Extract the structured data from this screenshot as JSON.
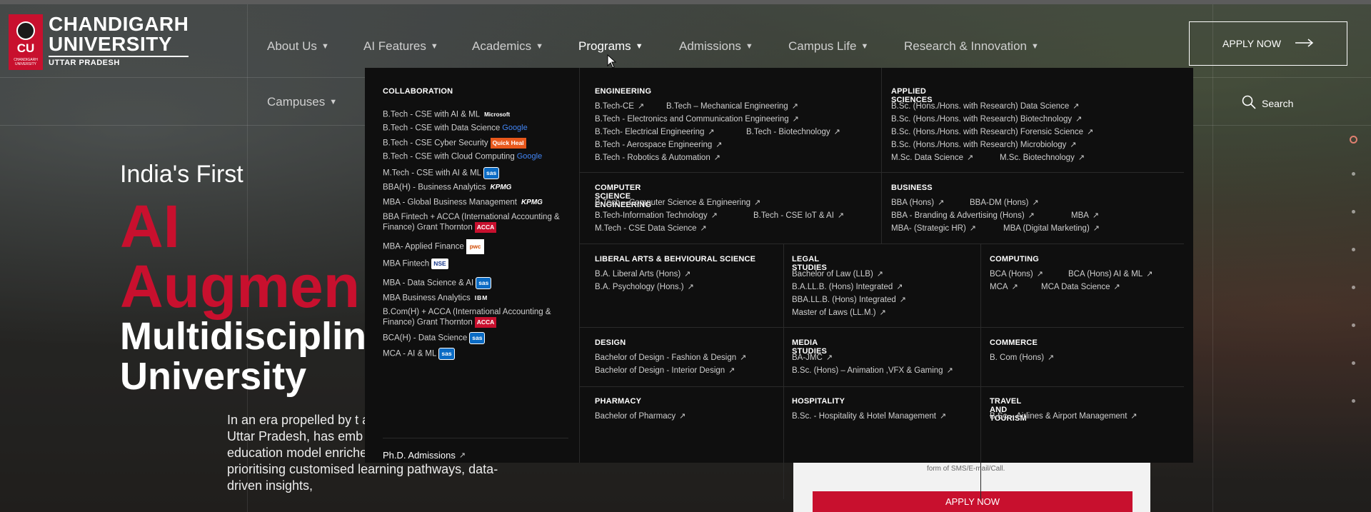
{
  "logo": {
    "line1": "CHANDIGARH",
    "line2": "UNIVERSITY",
    "line3": "UTTAR PRADESH",
    "badge": "CU",
    "badge_sub": "CHANDIGARH UNIVERSITY"
  },
  "nav": {
    "items": [
      {
        "label": "About Us"
      },
      {
        "label": "AI Features"
      },
      {
        "label": "Academics"
      },
      {
        "label": "Programs"
      },
      {
        "label": "Admissions"
      },
      {
        "label": "Campus Life"
      },
      {
        "label": "Research & Innovation"
      },
      {
        "label": "Campuses"
      }
    ],
    "apply_label": "APPLY NOW",
    "search_label": "Search"
  },
  "hero": {
    "line1": "India's First",
    "line2": "AI Augmen",
    "line3": "Multidisciplin University",
    "paragraph": "In an era propelled by t artificial intelligence, Cl Uttar Pradesh, has emb multidisciplinary education model enriched by AI integration, prioritising customised learning pathways, data-driven insights,"
  },
  "form": {
    "note": "form of SMS/E-mail/Call.",
    "apply_label": "APPLY NOW"
  },
  "menu": {
    "collaboration": {
      "heading": "COLLABORATION",
      "items": [
        {
          "label": "B.Tech - CSE with AI & ML",
          "partner": "Microsoft"
        },
        {
          "label": "B.Tech - CSE with Data Science",
          "partner": "Google"
        },
        {
          "label": "B.Tech - CSE Cyber Security",
          "partner": "Quick Heal"
        },
        {
          "label": "B.Tech - CSE with Cloud Computing",
          "partner": "Google"
        },
        {
          "label": "M.Tech - CSE with AI & ML",
          "partner": "sas"
        },
        {
          "label": "BBA(H) - Business Analytics",
          "partner": "KPMG"
        },
        {
          "label": "MBA - Global Business Management",
          "partner": "KPMG"
        },
        {
          "label": "BBA Fintech + ACCA (International Accounting & Finance) Grant Thornton",
          "partner": "ACCA"
        },
        {
          "label": "MBA- Applied Finance",
          "partner": "pwc"
        },
        {
          "label": "MBA Fintech",
          "partner": "NSE"
        },
        {
          "label": "MBA - Data Science & AI",
          "partner": "sas"
        },
        {
          "label": "MBA Business Analytics",
          "partner": "IBM"
        },
        {
          "label": "B.Com(H) + ACCA (International Accounting & Finance) Grant Thornton",
          "partner": "ACCA"
        },
        {
          "label": "BCA(H) - Data Science",
          "partner": "sas"
        },
        {
          "label": "MCA - AI & ML",
          "partner": "sas"
        }
      ],
      "phd": "Ph.D. Admissions"
    },
    "engineering": {
      "heading": "ENGINEERING",
      "items": [
        "B.Tech-CE",
        "B.Tech – Mechanical Engineering",
        "B.Tech - Electronics and Communication Engineering",
        "B.Tech- Electrical Engineering",
        "B.Tech - Biotechnology",
        "B.Tech - Aerospace Engineering",
        "B.Tech - Robotics & Automation"
      ]
    },
    "applied": {
      "heading": "APPLIED SCIENCES",
      "items": [
        "B.Sc. (Hons./Hons. with Research) Data Science",
        "B.Sc. (Hons./Hons. with Research) Biotechnology",
        "B.Sc. (Hons./Hons. with Research) Forensic Science",
        "B.Sc. (Hons./Hons. with Research) Microbiology",
        "M.Sc. Data Science",
        "M.Sc. Biotechnology"
      ]
    },
    "cse": {
      "heading": "COMPUTER SCIENCE ENGINEERING",
      "items": [
        "B.Tech – Computer Science & Engineering",
        "B.Tech-Information Technology",
        "B.Tech - CSE IoT & AI",
        "M.Tech - CSE Data Science"
      ]
    },
    "business": {
      "heading": "BUSINESS",
      "items": [
        "BBA (Hons)",
        "BBA-DM (Hons)",
        "BBA - Branding & Advertising (Hons)",
        "MBA",
        "MBA- (Strategic HR)",
        "MBA (Digital Marketing)"
      ]
    },
    "liberal": {
      "heading": "LIBERAL ARTS & BEHVIOURAL SCIENCE",
      "items": [
        "B.A. Liberal Arts (Hons)",
        "B.A. Psychology (Hons.)"
      ]
    },
    "legal": {
      "heading": "LEGAL STUDIES",
      "items": [
        "Bachelor of Law (LLB)",
        "B.A.LL.B. (Hons) Integrated",
        "BBA.LL.B. (Hons) Integrated",
        "Master of Laws (LL.M.)"
      ]
    },
    "computing": {
      "heading": "COMPUTING",
      "items": [
        "BCA (Hons)",
        "BCA (Hons) AI & ML",
        "MCA",
        "MCA Data Science"
      ]
    },
    "design": {
      "heading": "DESIGN",
      "items": [
        "Bachelor of Design - Fashion & Design",
        "Bachelor of Design - Interior Design"
      ]
    },
    "media": {
      "heading": "MEDIA STUDIES",
      "items": [
        "BA-JMC",
        "B.Sc. (Hons) – Animation ,VFX & Gaming"
      ]
    },
    "commerce": {
      "heading": "COMMERCE",
      "items": [
        "B. Com (Hons)"
      ]
    },
    "pharmacy": {
      "heading": "PHARMACY",
      "items": [
        "Bachelor of Pharmacy"
      ]
    },
    "hospitality": {
      "heading": "HOSPITALITY",
      "items": [
        "B.Sc. - Hospitality & Hotel Management"
      ]
    },
    "travel": {
      "heading": "TRAVEL AND TOURISM",
      "items": [
        "B.Sc. - Airlines & Airport Management"
      ]
    }
  },
  "colors": {
    "brand_red": "#c8102e",
    "menu_bg": "#0f0f0f"
  }
}
